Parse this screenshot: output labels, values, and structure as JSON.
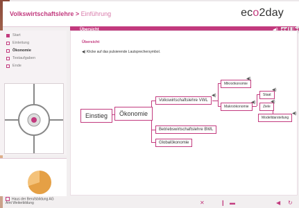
{
  "header": {
    "crumb_main": "Volkswirtschaftslehre",
    "crumb_sep": " > ",
    "crumb_sub": "Einführung",
    "logo_a": "ec",
    "logo_o": "o",
    "logo_b": "2day"
  },
  "topbar": {
    "title": "Übersicht"
  },
  "nav": {
    "items": [
      {
        "label": "Start"
      },
      {
        "label": "Einleitung"
      },
      {
        "label": "Ökonomie"
      },
      {
        "label": "Testaufgaben"
      },
      {
        "label": "Ende"
      }
    ]
  },
  "content": {
    "section_title": "Übersicht",
    "instruction": "Klicke auf das pulsierende Lautsprechersymbol.",
    "nodes": {
      "einstieg": "Einstieg",
      "oekonomie": "Ökonomie",
      "vwl": "Volkswirtschaftslehre VWL",
      "bwl": "Betriebswirtschaftslehre BWL",
      "global": "Globalökonomie",
      "mikro": "Mikroökonomie",
      "makro": "Makroökonomie",
      "staat": "Staat",
      "ziele": "Ziele",
      "modell": "Modelldarstellung"
    }
  },
  "footer": {
    "line1": "Haus der Berufsbildung AG",
    "line2": "Amt Weiterbildung"
  },
  "colors": {
    "accent": "#c23a7e"
  }
}
